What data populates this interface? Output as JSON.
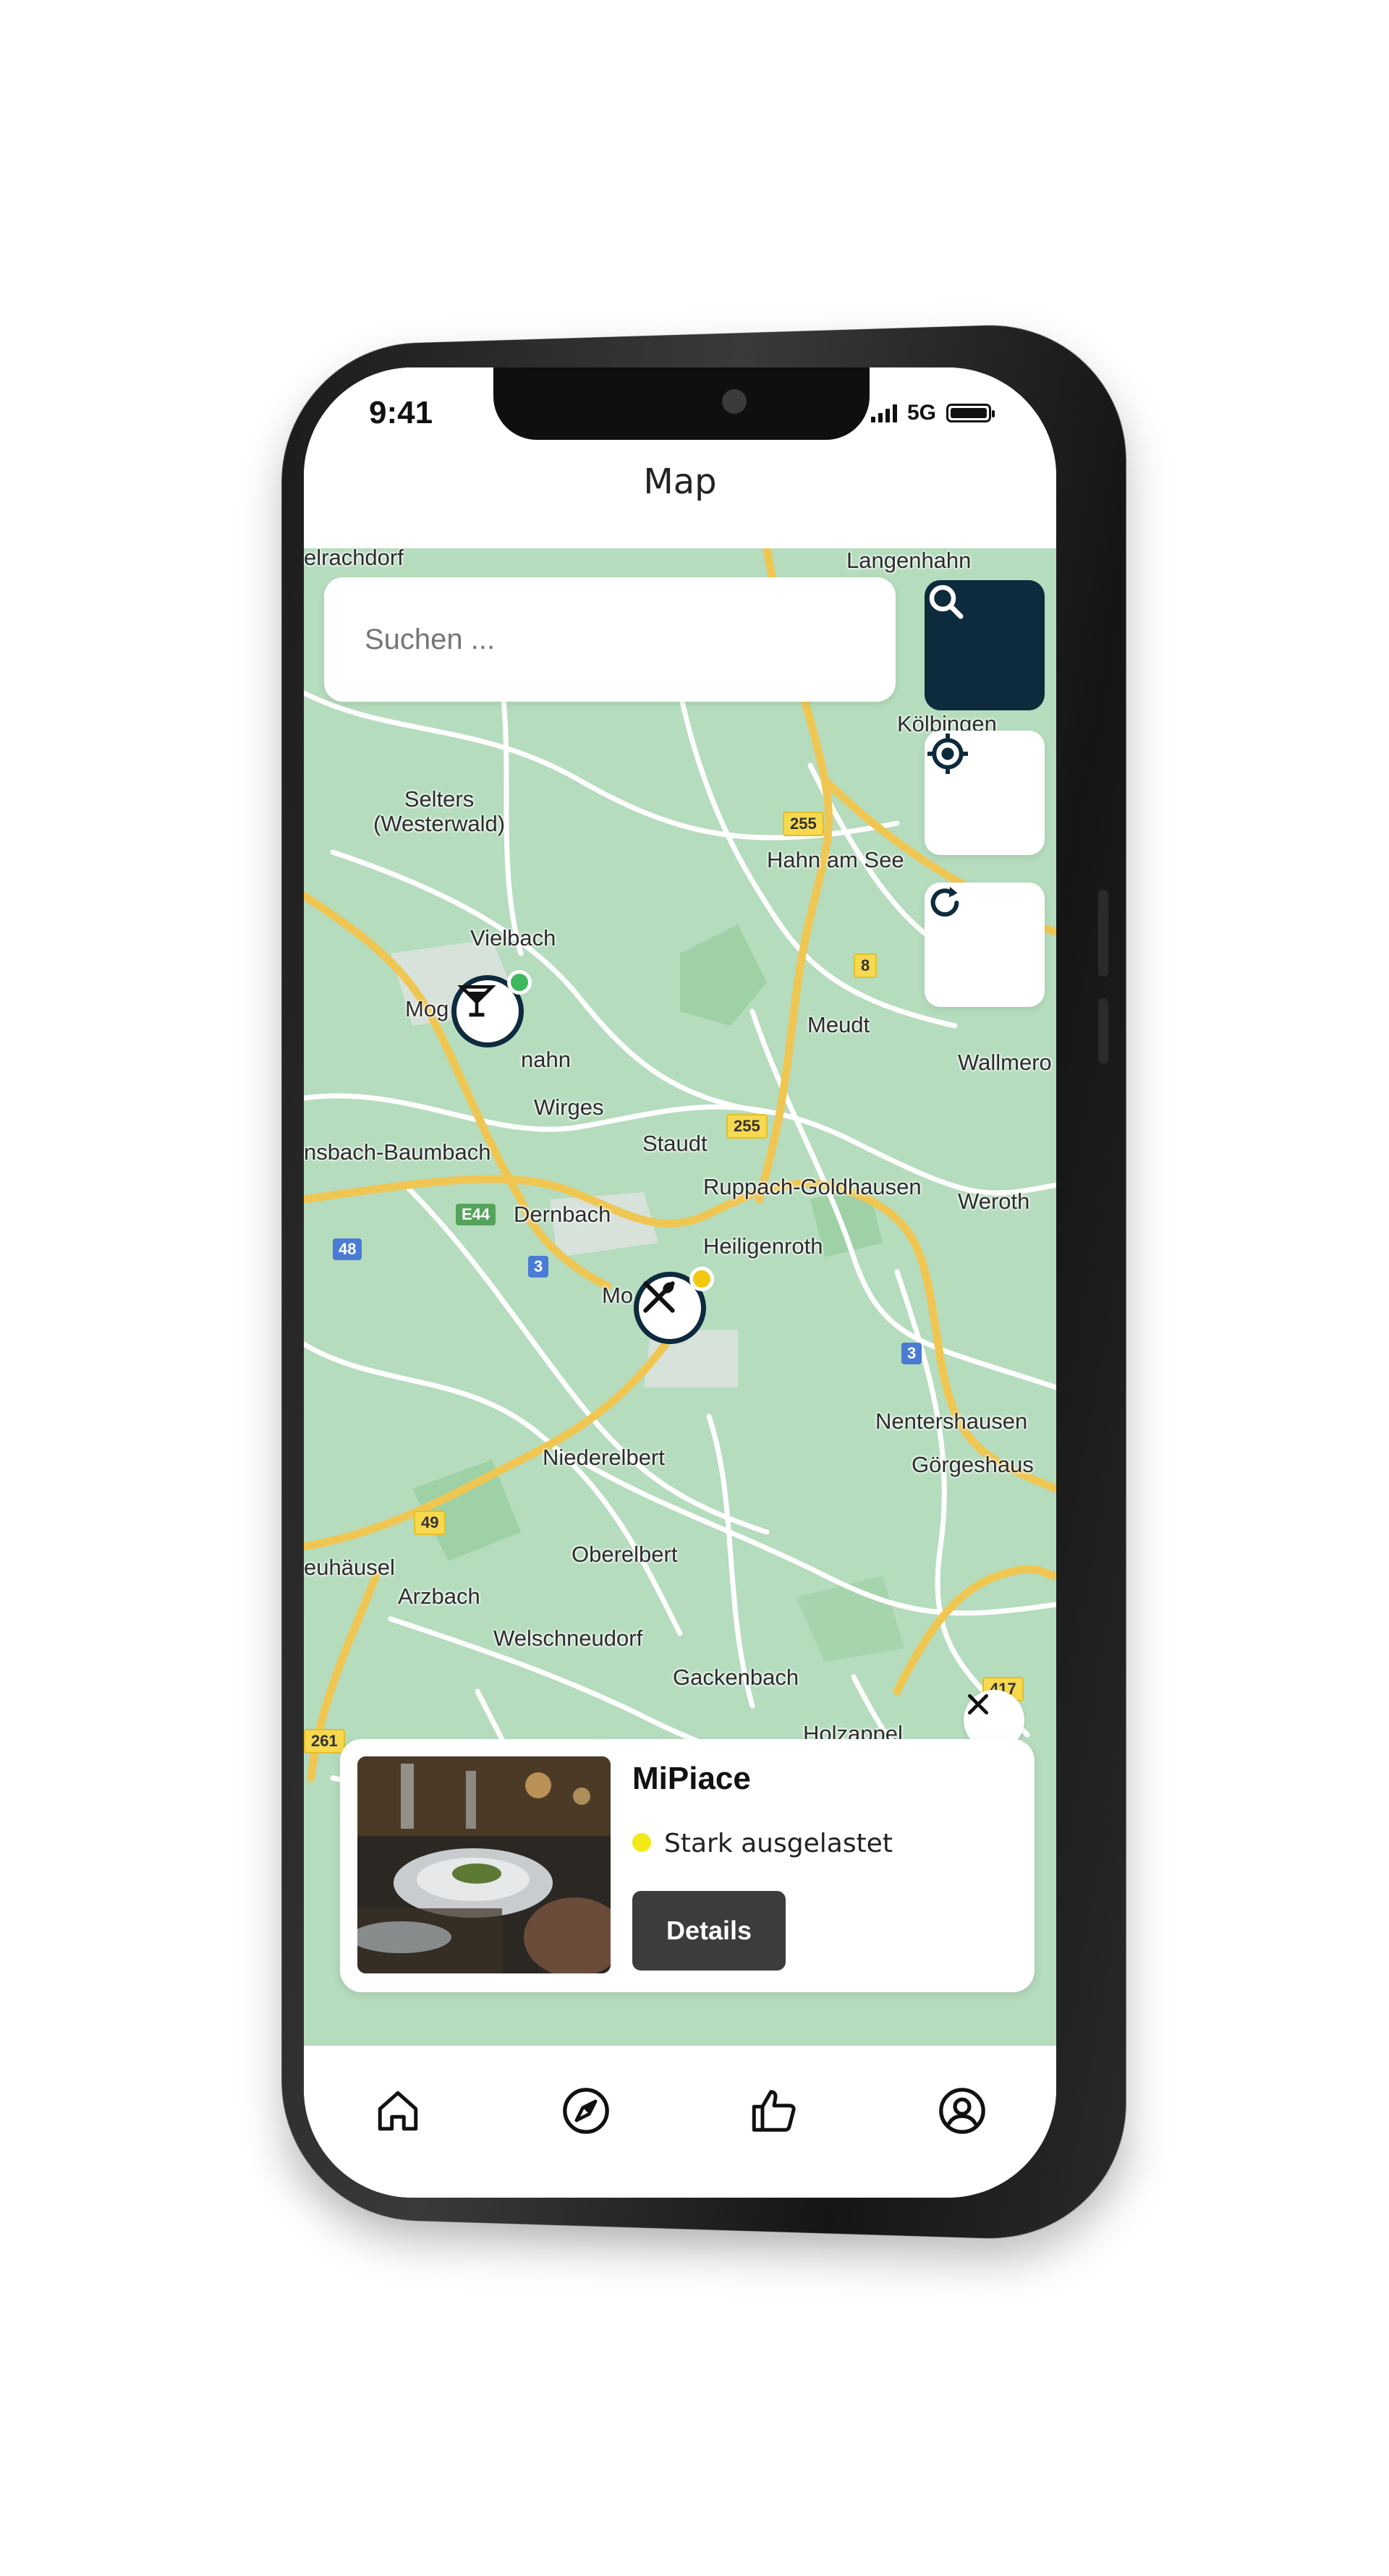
{
  "status_bar": {
    "time": "9:41",
    "network": "5G"
  },
  "header": {
    "title": "Map"
  },
  "search": {
    "placeholder": "Suchen ..."
  },
  "map": {
    "places": [
      "Selters\n(Westerwald)",
      "Vielbach",
      "Hahn am See",
      "Kölbingen",
      "Meudt",
      "Wallmero",
      "Wirges",
      "Staudt",
      "nsbach-Baumbach",
      "Dernbach",
      "Ruppach-Goldhausen",
      "Weroth",
      "Heiligenroth",
      "Nentershausen",
      "Görgeshaus",
      "Niederelbert",
      "Oberelbert",
      "euhäusel",
      "Arzbach",
      "Welschneudorf",
      "Gackenbach",
      "Holzappel",
      "Langenhahn",
      "elrachdorf",
      "Mog",
      "nahn",
      "Mo"
    ],
    "road_shields": [
      "255",
      "8",
      "255",
      "E44",
      "48",
      "3",
      "3",
      "49",
      "417",
      "261"
    ],
    "pins": [
      {
        "category": "bar",
        "icon": "cocktail-icon",
        "occupancy_color": "#3fb85c"
      },
      {
        "category": "restaurant",
        "icon": "cutlery-icon",
        "occupancy_color": "#f2c80f"
      }
    ]
  },
  "info_card": {
    "name": "MiPiace",
    "status": "Stark ausgelastet",
    "status_color": "#f2e81a",
    "details_label": "Details"
  },
  "tabs": [
    {
      "icon": "home-icon"
    },
    {
      "icon": "compass-icon"
    },
    {
      "icon": "thumbs-up-icon"
    },
    {
      "icon": "user-icon"
    }
  ],
  "colors": {
    "accent": "#0e2a3d",
    "map_background": "#b5dcbd",
    "button_dark": "#3c3c3c"
  }
}
